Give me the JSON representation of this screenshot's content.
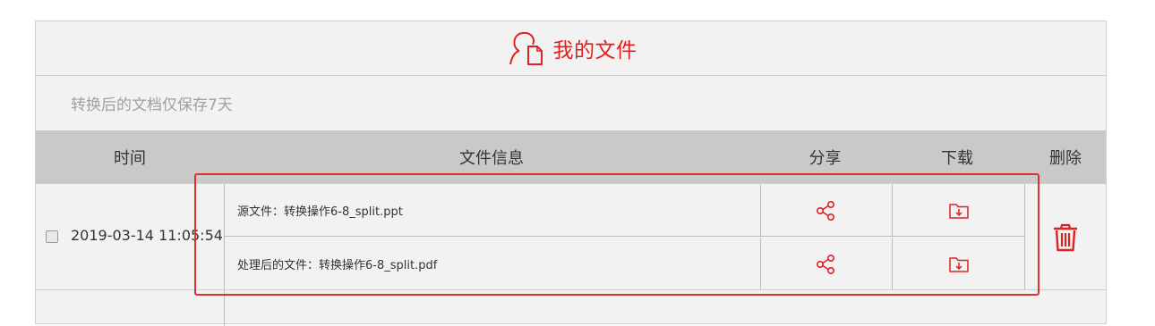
{
  "header": {
    "title": "我的文件",
    "icon": "user-file-icon"
  },
  "notice": {
    "text": "转换后的文档仅保存7天"
  },
  "table": {
    "columns": {
      "time": "时间",
      "file_info": "文件信息",
      "share": "分享",
      "download": "下载",
      "delete": "删除"
    },
    "rows": [
      {
        "checked": false,
        "time": "2019-03-14 11:05:54",
        "files": [
          {
            "label": "源文件：转换操作6-8_split.ppt",
            "share_icon": "share-icon",
            "download_icon": "folder-download-icon"
          },
          {
            "label": "处理后的文件：转换操作6-8_split.pdf",
            "share_icon": "share-icon",
            "download_icon": "folder-download-icon"
          }
        ],
        "delete_icon": "trash-icon"
      }
    ]
  },
  "colors": {
    "accent": "#e02020",
    "highlight": "#e03030",
    "panel_bg": "#f2f2f2",
    "header_bg": "#c9c9c9",
    "muted_text": "#a0a0a0"
  }
}
